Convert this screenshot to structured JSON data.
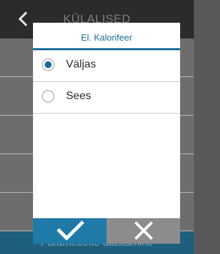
{
  "background": {
    "title": "KÜLALISED",
    "footer_text": "Parameetrite taastamine"
  },
  "dialog": {
    "title": "El. Kalorifeer",
    "options": [
      {
        "label": "Väljas",
        "selected": true
      },
      {
        "label": "Sees",
        "selected": false
      }
    ],
    "confirm_icon": "checkmark-icon",
    "cancel_icon": "close-icon"
  },
  "colors": {
    "accent": "#1a6b97",
    "confirm": "#1f7aa8",
    "cancel": "#8c8c8c"
  }
}
